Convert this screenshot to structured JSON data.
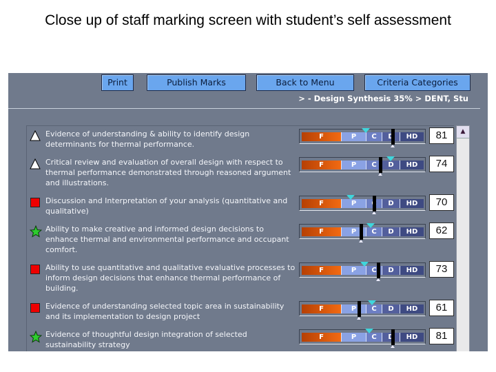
{
  "caption": "Close up of staff marking screen with student’s self assessment",
  "toolbar": {
    "print": "Print",
    "publish": "Publish Marks",
    "back": "Back to Menu",
    "criteria": "Criteria Categories"
  },
  "breadcrumb": "> - Design Synthesis 35% > DENT, Stu",
  "grade_bands": [
    "F",
    "P",
    "C",
    "D",
    "HD"
  ],
  "colors": {
    "background": "#707a8c",
    "button": "#6aa6ee",
    "self_assessment_marker": "#3fd6dc",
    "staff_marker": "#000000",
    "fail_band": "#f26a12"
  },
  "criteria": [
    {
      "icon": "triangle",
      "text": "Evidence of understanding & ability to identify design determinants for thermal performance.",
      "self_assessment": 65,
      "staff_mark": 81,
      "score": "81"
    },
    {
      "icon": "triangle",
      "text": "Critical review and evaluation of overall design with respect to thermal performance demonstrated through reasoned argument and illustrations.",
      "self_assessment": 80,
      "staff_mark": 74,
      "score": "74"
    },
    {
      "icon": "square",
      "text": "Discussion and Interpretation of your analysis (quantitative and qualitative)",
      "self_assessment": 56,
      "staff_mark": 70,
      "score": "70"
    },
    {
      "icon": "star",
      "text": "Ability to make creative and informed design decisions to enhance thermal and environmental performance and occupant comfort.",
      "self_assessment": 68,
      "staff_mark": 62,
      "score": "62"
    },
    {
      "icon": "square",
      "text": "Ability to use quantitative and qualitative evaluative processes to inform design decisions that enhance thermal performance of building.",
      "self_assessment": 64,
      "staff_mark": 73,
      "score": "73"
    },
    {
      "icon": "square",
      "text": "Evidence of understanding selected topic area in sustainability and its implementation to design project",
      "self_assessment": 69,
      "staff_mark": 61,
      "score": "61"
    },
    {
      "icon": "star",
      "text": "Evidence of thoughtful design integration of selected sustainability strategy",
      "self_assessment": 67,
      "staff_mark": 81,
      "score": "81"
    }
  ]
}
